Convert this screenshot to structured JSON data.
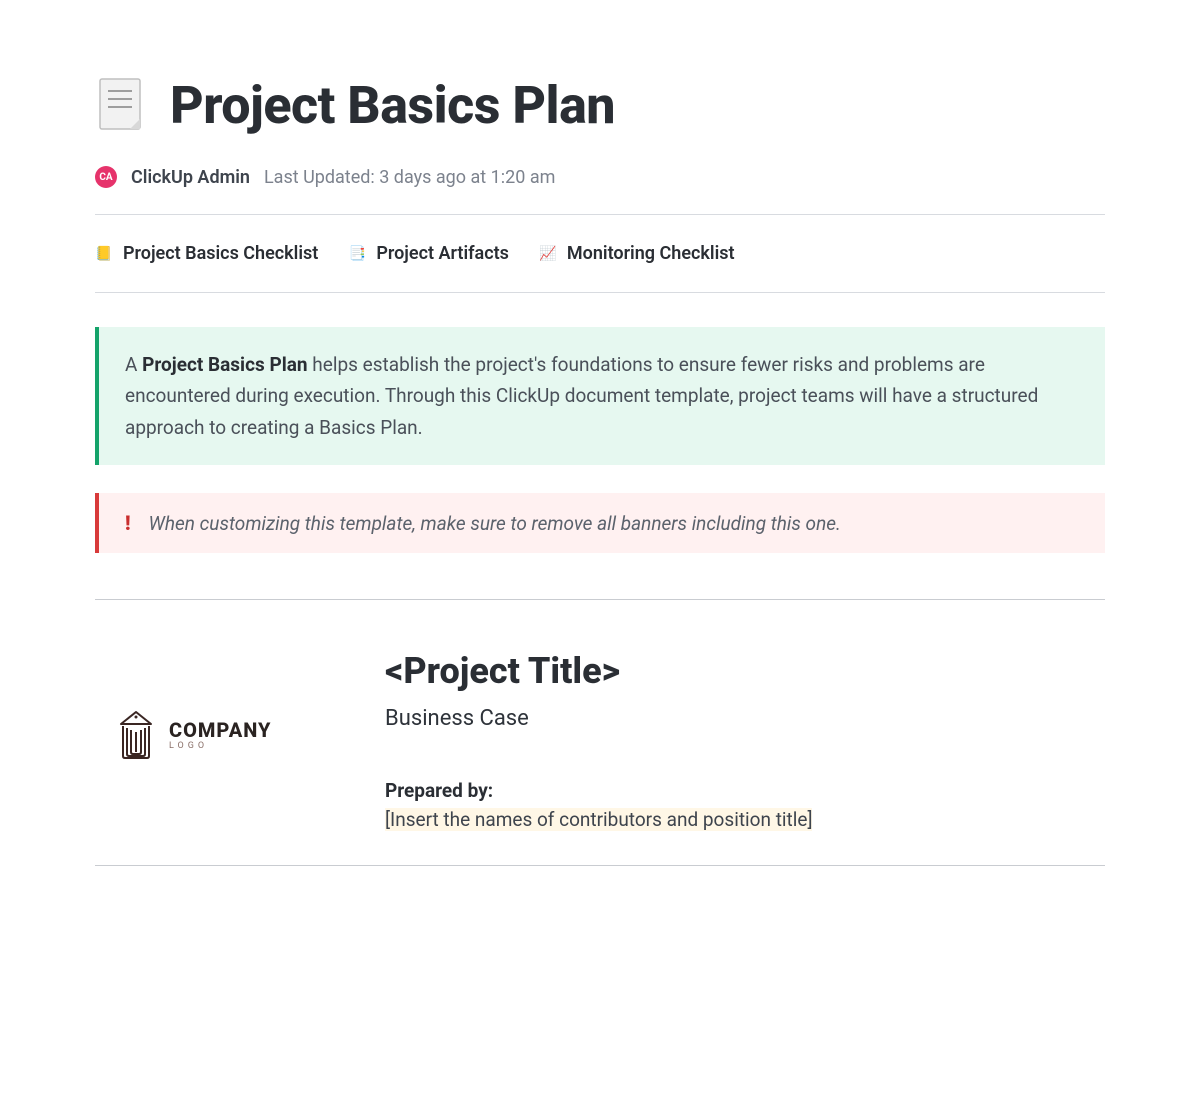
{
  "header": {
    "title": "Project Basics Plan",
    "author_initials": "CA",
    "author_name": "ClickUp Admin",
    "last_updated": "Last Updated: 3 days ago at 1:20 am"
  },
  "tabs": [
    {
      "icon": "📒",
      "label": "Project Basics Checklist"
    },
    {
      "icon": "📑",
      "label": "Project Artifacts"
    },
    {
      "icon": "📈",
      "label": "Monitoring Checklist"
    }
  ],
  "banner_green": {
    "prefix": "A ",
    "bold": "Project Basics Plan",
    "rest": " helps establish the project's foundations to ensure fewer risks and problems are encountered during execution. Through this ClickUp document template, project teams will have a structured approach to creating a Basics Plan."
  },
  "banner_red": {
    "icon": "!",
    "text": "When customizing this template, make sure to remove all banners including this one."
  },
  "logo": {
    "company": "COMPANY",
    "sub": "LOGO"
  },
  "body": {
    "project_title": "<Project Title>",
    "subtitle": "Business Case",
    "prepared_label": "Prepared by:",
    "prepared_value": "[Insert the names of contributors and position title]"
  }
}
